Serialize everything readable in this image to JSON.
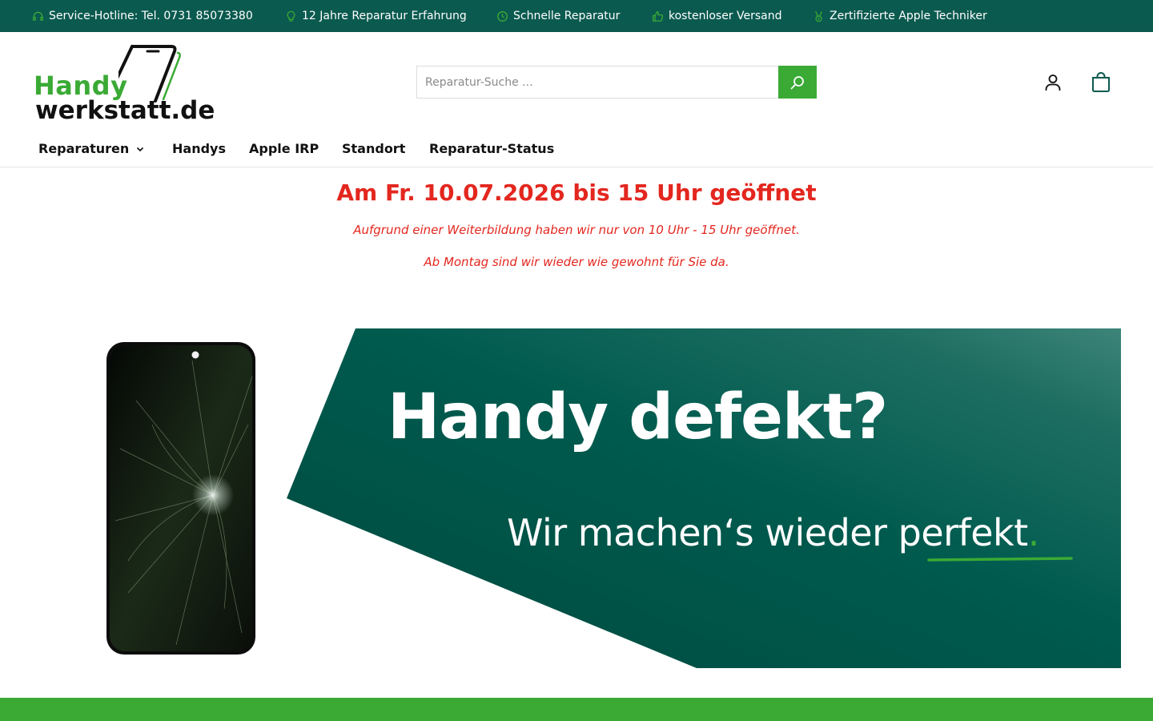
{
  "topbar": {
    "items": [
      {
        "icon": "headset-icon",
        "label": "Service-Hotline: Tel. 0731 85073380"
      },
      {
        "icon": "lightbulb-icon",
        "label": "12 Jahre Reparatur Erfahrung"
      },
      {
        "icon": "clock-icon",
        "label": "Schnelle Reparatur"
      },
      {
        "icon": "thumbs-up-icon",
        "label": "kostenloser Versand"
      },
      {
        "icon": "medal-icon",
        "label": "Zertifizierte Apple Techniker"
      }
    ]
  },
  "header": {
    "logo": {
      "line1": "Handy",
      "line2": "werkstatt.de"
    },
    "search": {
      "placeholder": "Reparatur-Suche ..."
    },
    "account_icon": "user-icon",
    "cart_icon": "shopping-bag-icon"
  },
  "nav": {
    "items": [
      {
        "label": "Reparaturen",
        "has_dropdown": true
      },
      {
        "label": "Handys"
      },
      {
        "label": "Apple IRP"
      },
      {
        "label": "Standort"
      },
      {
        "label": "Reparatur-Status"
      }
    ]
  },
  "notice": {
    "title": "Am Fr. 10.07.2026 bis 15 Uhr geöffnet",
    "line1": "Aufgrund einer Weiterbildung haben wir nur von 10 Uhr - 15 Uhr geöffnet.",
    "line2": "Ab Montag sind wir wieder wie gewohnt für Sie da."
  },
  "banner": {
    "headline": "Handy defekt?",
    "tagline": "Wir machen‘s wieder perfekt",
    "tagline_dot": "."
  },
  "colors": {
    "dark_green": "#0b5a4f",
    "brand_green": "#3aaa35",
    "notice_red": "#e3271f"
  }
}
